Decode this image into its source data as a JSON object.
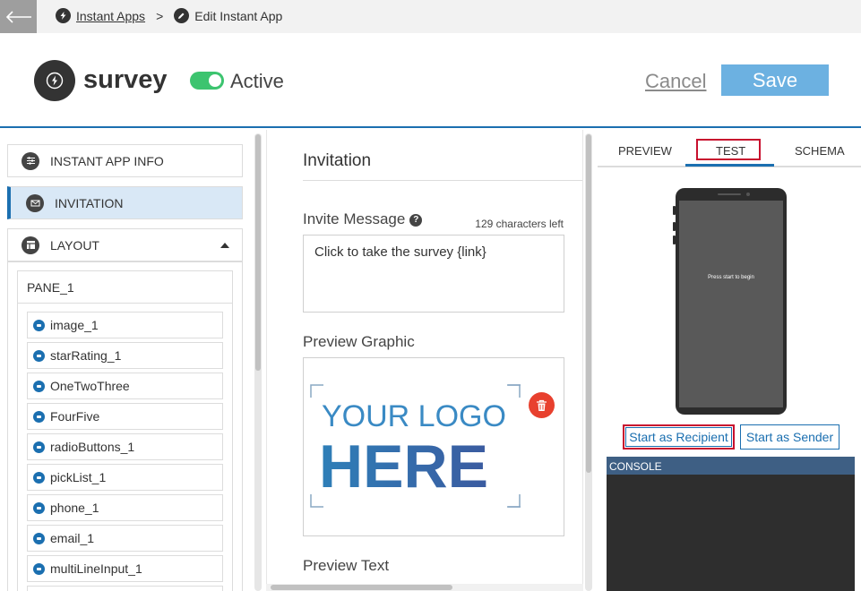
{
  "breadcrumb": {
    "parent": "Instant Apps",
    "separator": ">",
    "current": "Edit Instant App"
  },
  "header": {
    "app_name": "survey",
    "status_label": "Active",
    "cancel_label": "Cancel",
    "save_label": "Save"
  },
  "sidebar": {
    "items": [
      {
        "label": "INSTANT APP INFO",
        "icon": "sliders-icon"
      },
      {
        "label": "INVITATION",
        "icon": "envelope-icon"
      },
      {
        "label": "LAYOUT",
        "icon": "layout-icon"
      }
    ],
    "pane_title": "PANE_1",
    "components": [
      "image_1",
      "starRating_1",
      "OneTwoThree",
      "FourFive",
      "radioButtons_1",
      "pickList_1",
      "phone_1",
      "email_1",
      "multiLineInput_1"
    ]
  },
  "invitation": {
    "section_title": "Invitation",
    "message_label": "Invite Message",
    "chars_left": "129 characters left",
    "message_value": "Click to take the survey {link}",
    "graphic_label": "Preview Graphic",
    "logo_line1": "YOUR LOGO",
    "logo_line2": "HERE",
    "preview_text_label": "Preview Text"
  },
  "preview": {
    "tabs": [
      "PREVIEW",
      "TEST",
      "SCHEMA"
    ],
    "active_tab": "TEST",
    "phone_text": "Press start to begin",
    "start_recipient": "Start as Recipient",
    "start_sender": "Start as Sender",
    "console_label": "CONSOLE"
  },
  "colors": {
    "accent": "#1b6fb0",
    "save": "#6cb1e1",
    "toggle_on": "#3cc46f",
    "highlight": "#c8102e",
    "delete": "#e8402e"
  }
}
